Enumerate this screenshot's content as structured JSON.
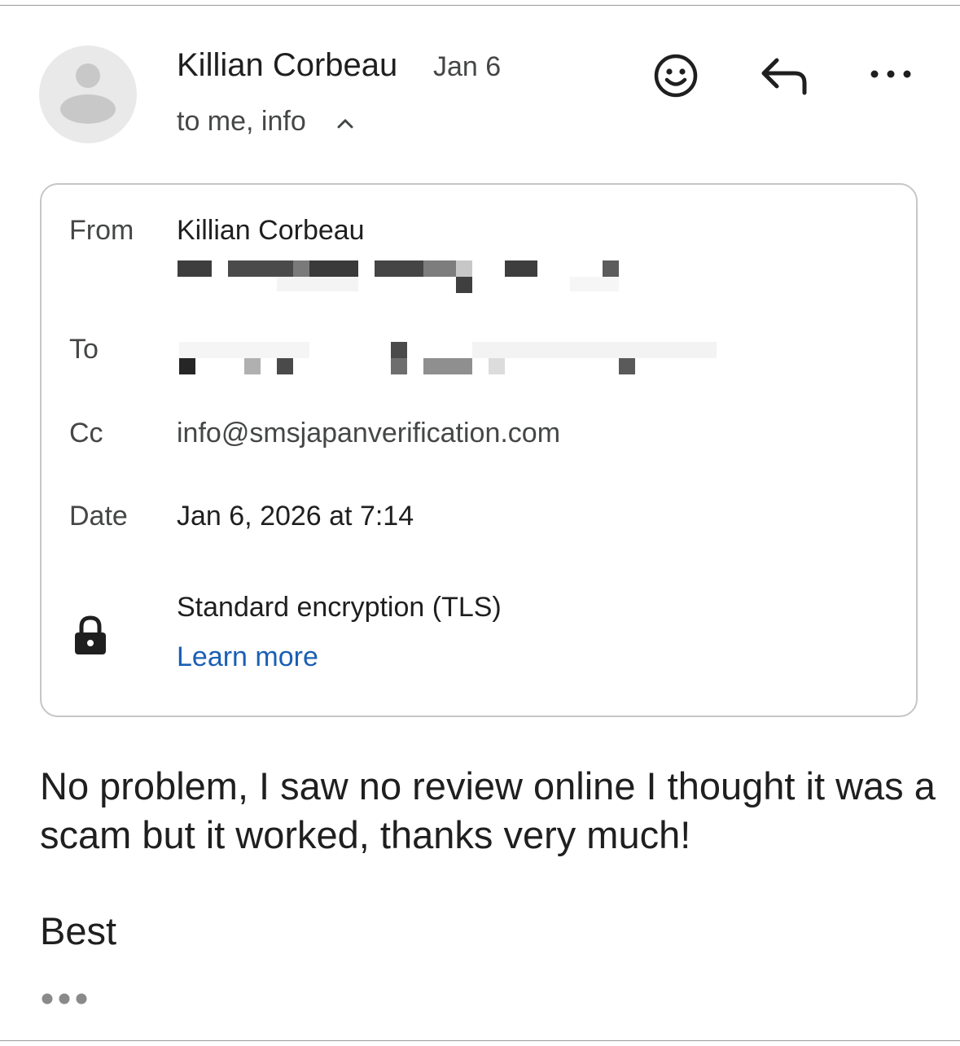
{
  "message": {
    "sender_name": "Killian Corbeau",
    "date_short": "Jan 6",
    "recipients_summary": "to me, info",
    "icons": {
      "avatar": "person-avatar-icon",
      "react": "emoji-smile-icon",
      "reply": "reply-arrow-icon",
      "more": "more-horizontal-icon",
      "expand": "chevron-up-icon",
      "lock": "lock-icon",
      "trimmed": "ellipsis-icon"
    }
  },
  "details": {
    "from_label": "From",
    "from_name": "Killian Corbeau",
    "to_label": "To",
    "cc_label": "Cc",
    "cc_value": "info@smsjapanverification.com",
    "date_label": "Date",
    "date_value": "Jan 6, 2026 at 7:14",
    "encryption_text": "Standard encryption (TLS)",
    "learn_more": "Learn more"
  },
  "body": {
    "paragraph": "No problem, I saw no review online I thought it was a scam but it worked, thanks very much!",
    "signoff": "Best"
  },
  "colors": {
    "link": "#1a5fb4",
    "text": "#1f1f1f",
    "secondary": "#444746",
    "border": "#c6c6c6"
  }
}
